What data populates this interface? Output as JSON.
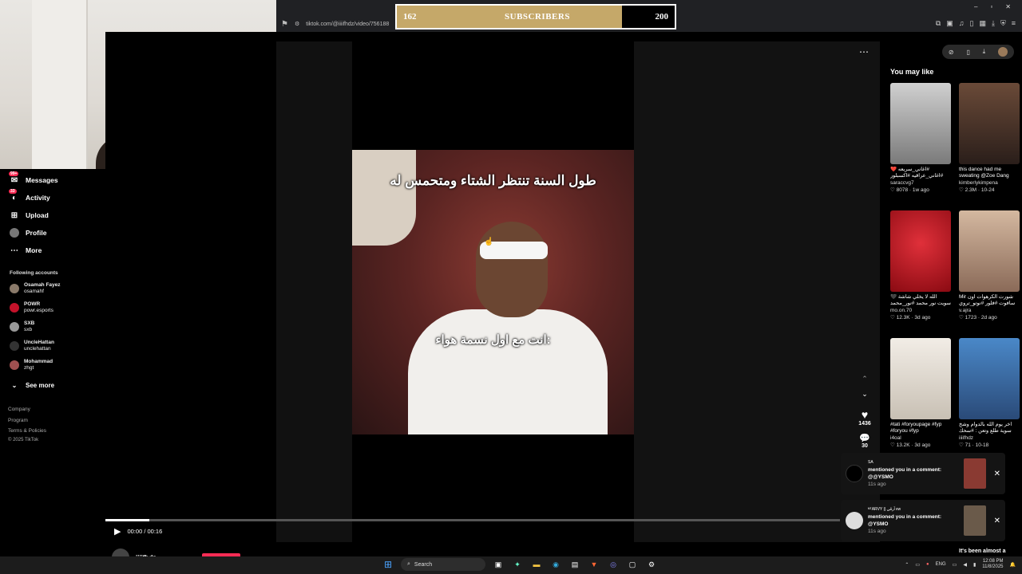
{
  "browser": {
    "url": "tiktok.com/@iiiifhdz/video/756188",
    "window_controls": [
      "–",
      "▫",
      "✕"
    ]
  },
  "subscribers": {
    "current": "162",
    "label": "SUBSCRIBERS",
    "goal": "200",
    "progress_fraction": 0.81,
    "fill_color": "#c5a869"
  },
  "sidebar": {
    "items": [
      {
        "label": "Messages",
        "icon": "messages-icon",
        "badge": "99+"
      },
      {
        "label": "Activity",
        "icon": "activity-icon",
        "badge": "33"
      },
      {
        "label": "Upload",
        "icon": "upload-icon"
      },
      {
        "label": "Profile",
        "icon": "profile-avatar"
      },
      {
        "label": "More",
        "icon": "more-icon"
      }
    ],
    "following_title": "Following accounts",
    "accounts": [
      {
        "name": "Osamah Fayez",
        "handle": "osamahf"
      },
      {
        "name": "POWR",
        "handle": "powr.esports"
      },
      {
        "name": "SXB",
        "handle": "sxb"
      },
      {
        "name": "UncleHattan",
        "handle": "unclehattan"
      },
      {
        "name": "Mohammad",
        "handle": "zhgt"
      }
    ],
    "see_more": "See more",
    "footer": [
      "Company",
      "Program",
      "Terms & Policies",
      "© 2025 TikTok"
    ]
  },
  "video": {
    "caption_top": "طول السنة تنتظر الشتاء ومتحمس له",
    "caption_bottom": "انت مع اول نسمة هواء:",
    "time": "00:00 / 00:16",
    "progress_fraction": 0.06,
    "author": "iiiifhdz"
  },
  "actions": {
    "likes": "1436",
    "comments": "30"
  },
  "right_rail": {
    "title": "You may like",
    "cards": [
      {
        "caption": "#اغاني_سريعه ❤️ #اغاني_عراقيه #اكسبلور",
        "author": "saraccvg7",
        "likes": "8078",
        "age": "1w ago",
        "thumb": "#b9b9b9"
      },
      {
        "caption": "this dance had me sweating @Zoe Dang",
        "author": "kimberlykimpena",
        "likes": "2.3M",
        "age": "10-24",
        "thumb": "#3a2a22"
      },
      {
        "caption": "الله لا يخلي شاشة 🖤 سويت نور محمد #نور_محمد",
        "author": "mo.on.70",
        "likes": "12.3K",
        "age": "3d ago",
        "thumb": "#b0141c"
      },
      {
        "caption": "شورت الكرهوات اون Mir سافوت #فلور #نوتو_تروي",
        "author": "v.ajra",
        "likes": "1723",
        "age": "2d ago",
        "thumb": "#c7a98f"
      },
      {
        "caption": "#tati #foryoupage #fyp #foryou #fyp",
        "author": "i4oal",
        "likes": "13.2K",
        "age": "3d ago",
        "thumb": "#e6e1da"
      },
      {
        "caption": "آخر يوم الله بالدوام وشخ سوية طلع وتعن : #سحك",
        "author": "iiiifhdz",
        "likes": "71",
        "age": "10-18",
        "thumb": "#3a6fa8"
      }
    ],
    "bottom_caption": "It's been almost a"
  },
  "notifications": [
    {
      "user": "SA",
      "text": "mentioned you in a comment: @@YSMO",
      "time": "11s ago"
    },
    {
      "user": "ᴹᵀARVY || آرڤي кw",
      "text": "mentioned you in a comment: @YSMO",
      "time": "11s ago"
    }
  ],
  "taskbar": {
    "search_placeholder": "Search",
    "lang": "ENG",
    "time": "12:08 PM",
    "date": "11/8/2025"
  }
}
